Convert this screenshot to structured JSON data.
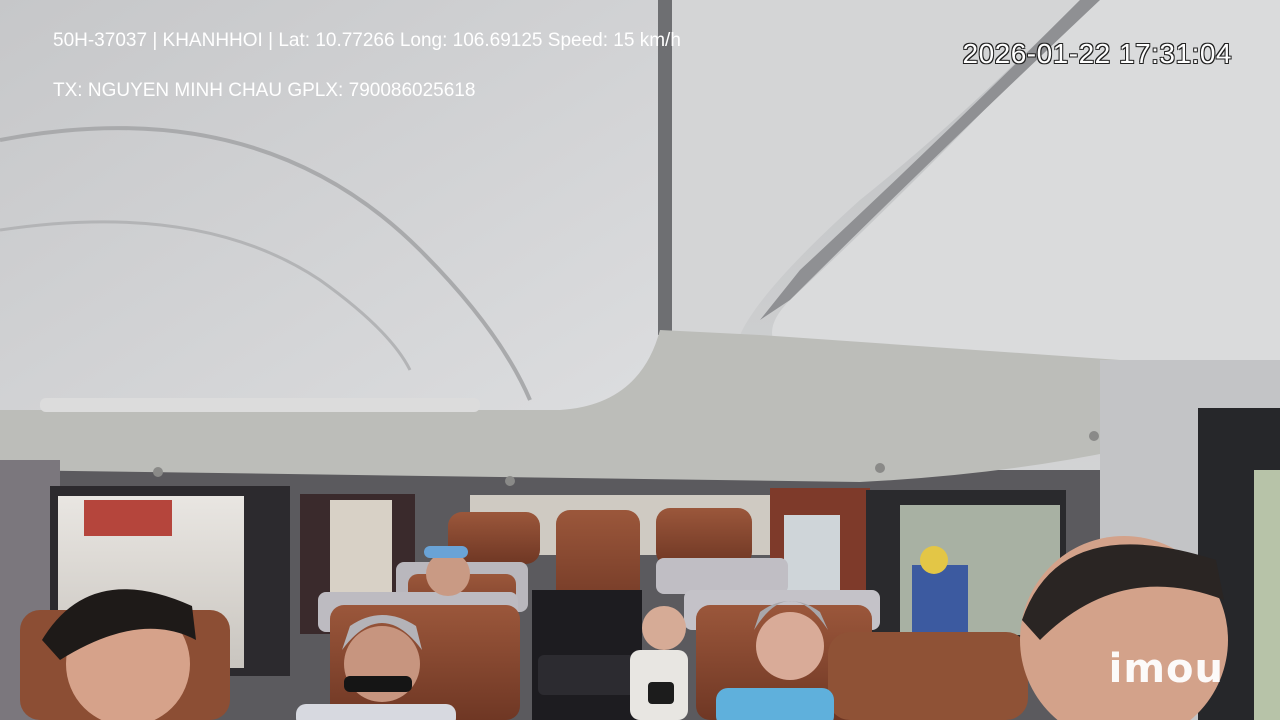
{
  "overlay": {
    "plate": "50H-37037",
    "company": "KHANHHOI",
    "lat_label": "Lat:",
    "lat": "10.77266",
    "long_label": "Long:",
    "long": "106.69125",
    "speed_label": "Speed:",
    "speed": "15 km/h",
    "driver_label": "TX:",
    "driver": "NGUYEN MINH CHAU",
    "license_label": "GPLX:",
    "license": "790086025618",
    "timestamp": "2026-01-22 17:31:04"
  },
  "brand": {
    "logo_text": "imou"
  },
  "icons": {
    "logo": "imou-logo-icon"
  },
  "colors": {
    "ceiling": "#c9cacb",
    "seat_leather": "#8a4a32",
    "osd_text": "#ffffff"
  }
}
